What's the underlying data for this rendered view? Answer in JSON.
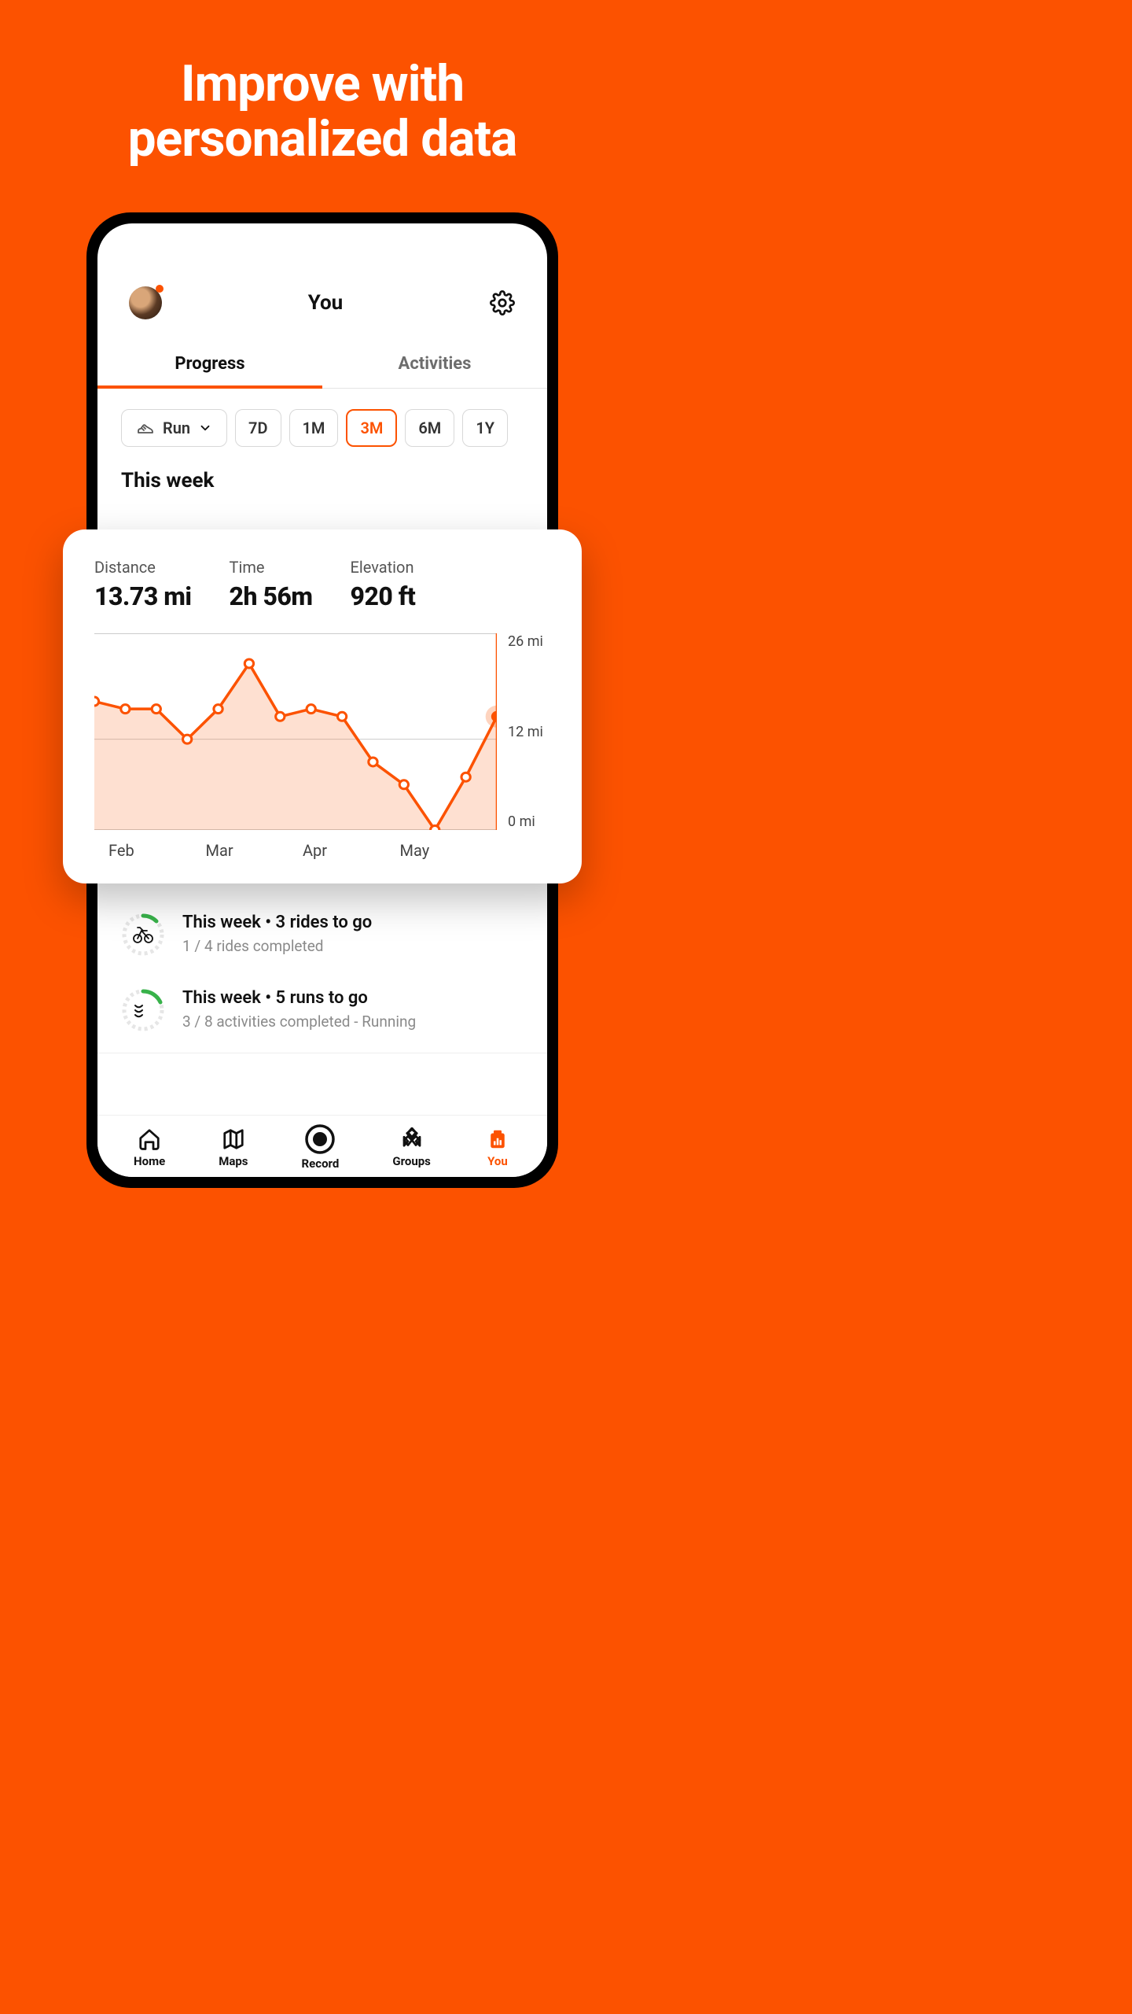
{
  "hero": {
    "line1": "Improve with",
    "line2": "personalized data"
  },
  "header": {
    "title": "You"
  },
  "tabs": {
    "progress": "Progress",
    "activities": "Activities",
    "active": "progress"
  },
  "filters": {
    "activity": "Run",
    "ranges": [
      "7D",
      "1M",
      "3M",
      "6M",
      "1Y"
    ],
    "selected": "3M"
  },
  "section": {
    "this_week": "This week"
  },
  "stats": {
    "distance_label": "Distance",
    "distance_value": "13.73 mi",
    "time_label": "Time",
    "time_value": "2h 56m",
    "elevation_label": "Elevation",
    "elevation_value": "920 ft"
  },
  "chart_data": {
    "type": "line",
    "title": "",
    "xlabel": "",
    "ylabel": "Distance",
    "y_unit": "mi",
    "ylim": [
      0,
      26
    ],
    "y_ticks": [
      26,
      12,
      0
    ],
    "y_tick_labels": [
      "26 mi",
      "12 mi",
      "0 mi"
    ],
    "x_tick_labels": [
      "Feb",
      "Mar",
      "Apr",
      "May"
    ],
    "x": [
      0,
      1,
      2,
      3,
      4,
      5,
      6,
      7,
      8,
      9,
      10,
      11,
      12,
      13
    ],
    "values": [
      17,
      16,
      16,
      12,
      16,
      22,
      15,
      16,
      15,
      9,
      6,
      0,
      7,
      15
    ],
    "highlight_index": 13,
    "color": "#fc5200"
  },
  "goals": [
    {
      "icon": "bike",
      "title": "This week • 3 rides to go",
      "subtitle": "1 / 4 rides completed",
      "progress": 0.25
    },
    {
      "icon": "runner",
      "title": "This week • 5 runs to go",
      "subtitle": "3 / 8 activities completed - Running",
      "progress": 0.375
    }
  ],
  "nav": {
    "items": [
      {
        "label": "Home",
        "icon": "home"
      },
      {
        "label": "Maps",
        "icon": "maps"
      },
      {
        "label": "Record",
        "icon": "record"
      },
      {
        "label": "Groups",
        "icon": "groups"
      },
      {
        "label": "You",
        "icon": "you"
      }
    ],
    "active": "You"
  }
}
